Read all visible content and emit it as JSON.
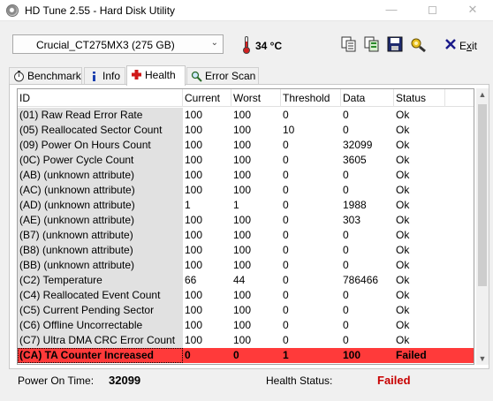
{
  "window": {
    "title": "HD Tune 2.55 - Hard Disk Utility",
    "minimize": "—",
    "close": "✕"
  },
  "toolbar": {
    "drive": "Crucial_CT275MX3 (275 GB)",
    "temperature": "34 °C",
    "exit_prefix": "E",
    "exit_underlined": "x",
    "exit_suffix": "it"
  },
  "tabs": [
    {
      "label": "Benchmark",
      "icon": "stopwatch-icon"
    },
    {
      "label": "Info",
      "icon": "info-icon"
    },
    {
      "label": "Health",
      "icon": "health-cross-icon",
      "active": true
    },
    {
      "label": "Error Scan",
      "icon": "magnifier-icon"
    }
  ],
  "table": {
    "columns": [
      "ID",
      "Current",
      "Worst",
      "Threshold",
      "Data",
      "Status"
    ],
    "rows": [
      [
        "(01) Raw Read Error Rate",
        "100",
        "100",
        "0",
        "0",
        "Ok"
      ],
      [
        "(05) Reallocated Sector Count",
        "100",
        "100",
        "10",
        "0",
        "Ok"
      ],
      [
        "(09) Power On Hours Count",
        "100",
        "100",
        "0",
        "32099",
        "Ok"
      ],
      [
        "(0C) Power Cycle Count",
        "100",
        "100",
        "0",
        "3605",
        "Ok"
      ],
      [
        "(AB) (unknown attribute)",
        "100",
        "100",
        "0",
        "0",
        "Ok"
      ],
      [
        "(AC) (unknown attribute)",
        "100",
        "100",
        "0",
        "0",
        "Ok"
      ],
      [
        "(AD) (unknown attribute)",
        "1",
        "1",
        "0",
        "1988",
        "Ok"
      ],
      [
        "(AE) (unknown attribute)",
        "100",
        "100",
        "0",
        "303",
        "Ok"
      ],
      [
        "(B7) (unknown attribute)",
        "100",
        "100",
        "0",
        "0",
        "Ok"
      ],
      [
        "(B8) (unknown attribute)",
        "100",
        "100",
        "0",
        "0",
        "Ok"
      ],
      [
        "(BB) (unknown attribute)",
        "100",
        "100",
        "0",
        "0",
        "Ok"
      ],
      [
        "(C2) Temperature",
        "66",
        "44",
        "0",
        "786466",
        "Ok"
      ],
      [
        "(C4) Reallocated Event Count",
        "100",
        "100",
        "0",
        "0",
        "Ok"
      ],
      [
        "(C5) Current Pending Sector",
        "100",
        "100",
        "0",
        "0",
        "Ok"
      ],
      [
        "(C6) Offline Uncorrectable",
        "100",
        "100",
        "0",
        "0",
        "Ok"
      ],
      [
        "(C7) Ultra DMA CRC Error Count",
        "100",
        "100",
        "0",
        "0",
        "Ok"
      ],
      [
        "(CA) TA Counter Increased",
        "0",
        "0",
        "1",
        "100",
        "Failed"
      ]
    ],
    "failed_row_color": "#ff3a3a"
  },
  "status_bar": {
    "power_on_label": "Power On Time:",
    "power_on_value": "32099",
    "health_label": "Health Status:",
    "health_value": "Failed",
    "health_color": "#c80000"
  }
}
